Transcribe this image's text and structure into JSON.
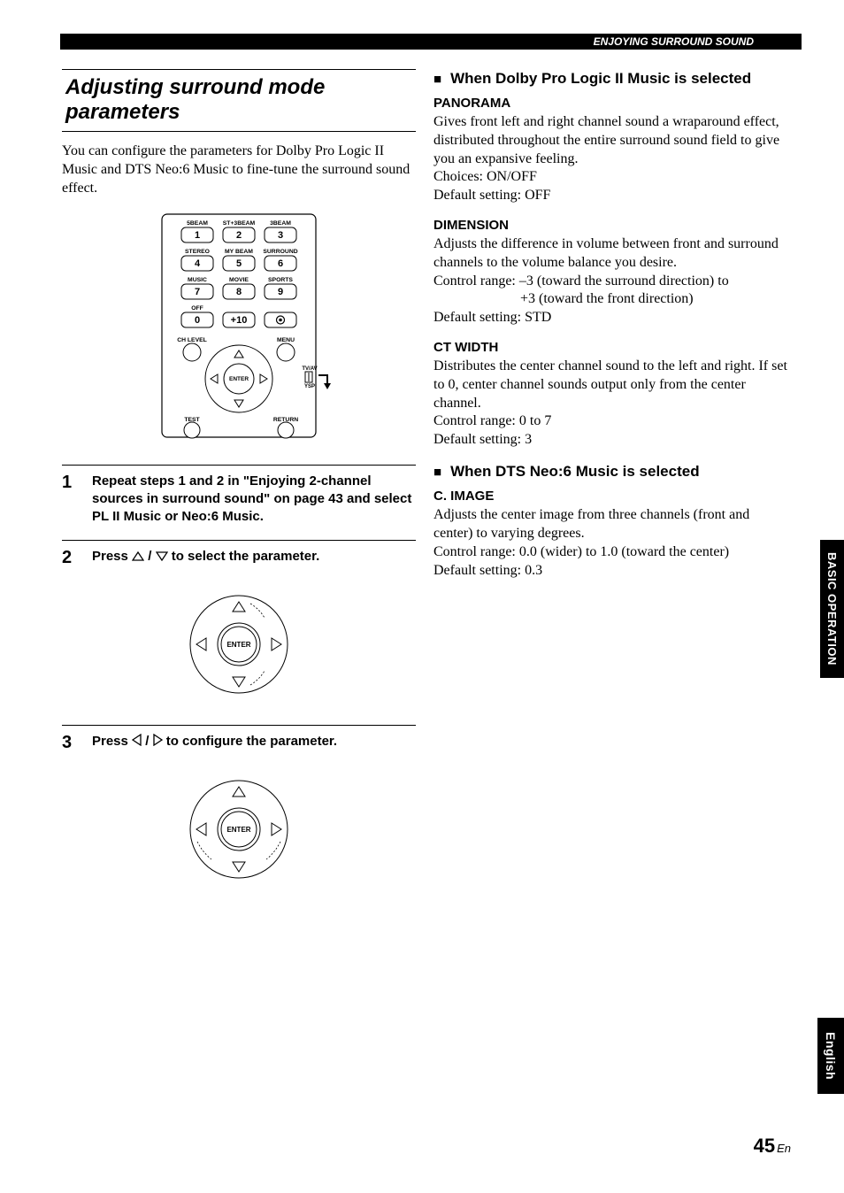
{
  "header": {
    "running_title": "ENJOYING SURROUND SOUND"
  },
  "left": {
    "section_title": "Adjusting surround mode parameters",
    "intro": "You can configure the parameters for Dolby Pro Logic II Music and DTS Neo:6 Music to fine-tune the surround sound effect.",
    "remote": {
      "row1": {
        "l1": "5BEAM",
        "l2": "ST+3BEAM",
        "l3": "3BEAM",
        "b1": "1",
        "b2": "2",
        "b3": "3"
      },
      "row2": {
        "l1": "STEREO",
        "l2": "MY BEAM",
        "l3": "SURROUND",
        "b1": "4",
        "b2": "5",
        "b3": "6"
      },
      "row3": {
        "l1": "MUSIC",
        "l2": "MOVIE",
        "l3": "SPORTS",
        "b1": "7",
        "b2": "8",
        "b3": "9"
      },
      "row4": {
        "l1": "OFF",
        "l2": "",
        "l3": "",
        "b1": "0",
        "b2": "+10",
        "b3_icon": "record-icon"
      },
      "ch_level": "CH LEVEL",
      "menu": "MENU",
      "enter": "ENTER",
      "tvav": "TV/AV",
      "ysp": "YSP",
      "test": "TEST",
      "return": "RETURN"
    },
    "steps": [
      {
        "num": "1",
        "text": "Repeat steps 1 and 2 in \"Enjoying 2-channel sources in surround sound\" on page 43 and select PL II Music or Neo:6 Music."
      },
      {
        "num": "2",
        "text_pre": "Press ",
        "text_mid": " / ",
        "text_post": " to select the parameter."
      },
      {
        "num": "3",
        "text_pre": "Press ",
        "text_mid": " / ",
        "text_post": " to configure the parameter."
      }
    ],
    "dpad_enter": "ENTER"
  },
  "right": {
    "h1": "When Dolby Pro Logic II Music is selected",
    "panorama": {
      "title": "PANORAMA",
      "desc": "Gives front left and right channel sound a wraparound effect, distributed throughout the entire surround sound field to give you an expansive feeling.",
      "choices": "Choices: ON/OFF",
      "default": "Default setting: OFF"
    },
    "dimension": {
      "title": "DIMENSION",
      "desc": "Adjusts the difference in volume between front and surround channels to the volume balance you desire.",
      "range1": "Control range: –3 (toward the surround direction) to",
      "range2": "+3 (toward the front direction)",
      "default": "Default setting: STD"
    },
    "ctwidth": {
      "title": "CT WIDTH",
      "desc": "Distributes the center channel sound to the left and right. If set to 0, center channel sounds output only from the center channel.",
      "range": "Control range: 0 to 7",
      "default": "Default setting: 3"
    },
    "h2": "When DTS Neo:6 Music is selected",
    "cimage": {
      "title": "C. IMAGE",
      "desc": "Adjusts the center image from three channels (front and center) to varying degrees.",
      "range": "Control range: 0.0 (wider) to 1.0 (toward the center)",
      "default": "Default setting: 0.3"
    }
  },
  "tabs": {
    "operation": "BASIC OPERATION",
    "language": "English"
  },
  "footer": {
    "page": "45",
    "suffix": "En"
  }
}
